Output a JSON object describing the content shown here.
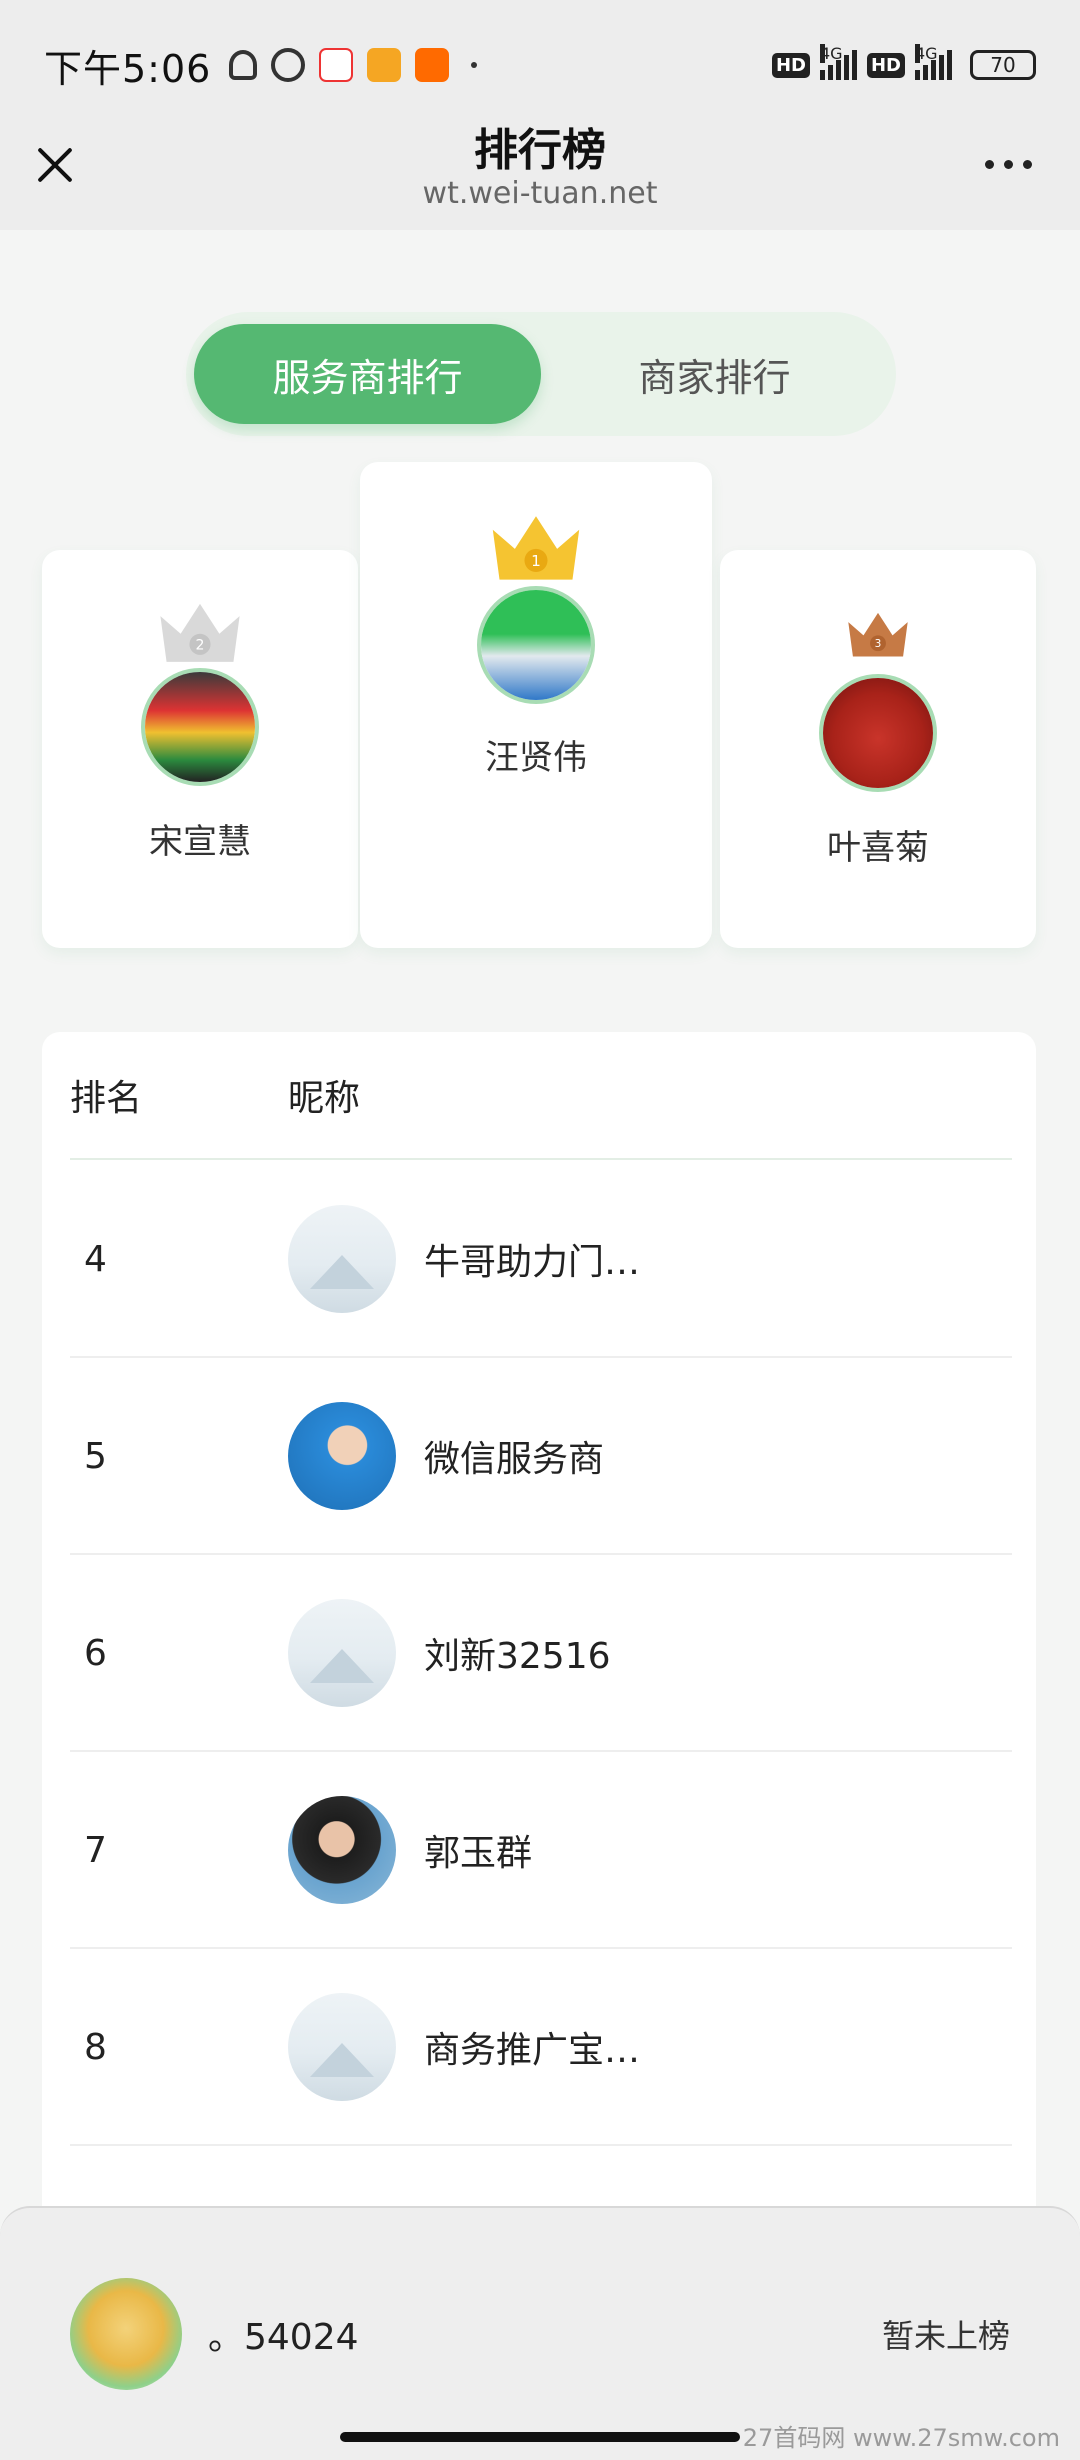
{
  "status_bar": {
    "time": "下午5:06",
    "network1": "4G",
    "network2": "4G",
    "hd1": "HD",
    "hd2": "HD",
    "battery": "70"
  },
  "header": {
    "title": "排行榜",
    "domain": "wt.wei-tuan.net"
  },
  "tabs": [
    {
      "label": "服务商排行",
      "active": true
    },
    {
      "label": "商家排行",
      "active": false
    }
  ],
  "podium": {
    "first": {
      "rank": "1",
      "name": "汪贤伟"
    },
    "second": {
      "rank": "2",
      "name": "宋宣慧"
    },
    "third": {
      "rank": "3",
      "name": "叶喜菊"
    }
  },
  "table": {
    "headers": {
      "rank": "排名",
      "nickname": "昵称"
    },
    "rows": [
      {
        "rank": "4",
        "name": "牛哥助力门…"
      },
      {
        "rank": "5",
        "name": "微信服务商"
      },
      {
        "rank": "6",
        "name": "刘新32516"
      },
      {
        "rank": "7",
        "name": "郭玉群"
      },
      {
        "rank": "8",
        "name": "商务推广宝…"
      }
    ]
  },
  "my_rank": {
    "name": "。54024",
    "status": "暂未上榜"
  },
  "watermark": "27首码网  www.27smw.com",
  "colors": {
    "accent": "#55b872",
    "gold": "#f5c431",
    "silver": "#d9d9d9",
    "bronze": "#c67a45"
  }
}
